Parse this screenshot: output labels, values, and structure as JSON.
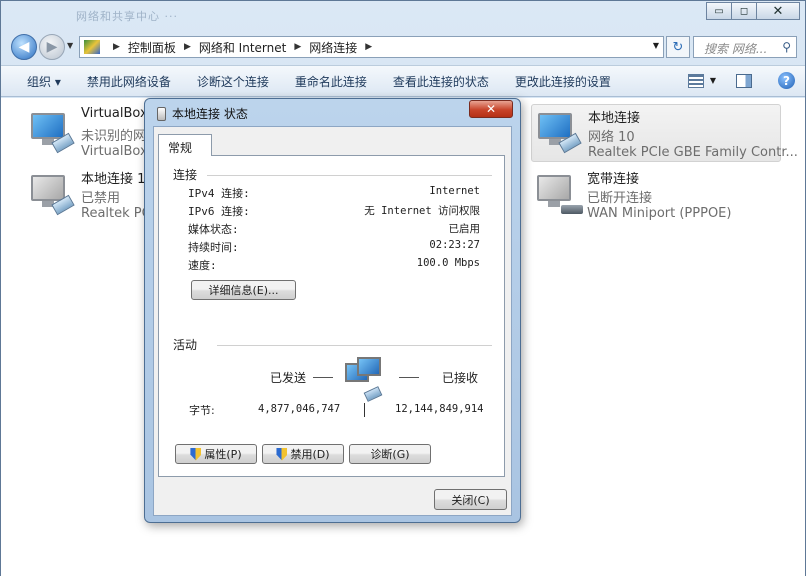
{
  "window": {
    "title_ghost": "网络和共享中心 ···",
    "min_glyph": "▭",
    "max_glyph": "◻",
    "close_glyph": "✕"
  },
  "nav": {
    "back_glyph": "◀",
    "forward_glyph": "▶",
    "breadcrumbs": [
      "控制面板",
      "网络和 Internet",
      "网络连接"
    ],
    "search_placeholder": "搜索 网络...",
    "refresh_glyph": "↻"
  },
  "toolbar": {
    "organize": "组织 ▾",
    "disable": "禁用此网络设备",
    "diagnose": "诊断这个连接",
    "rename": "重命名此连接",
    "view_status": "查看此连接的状态",
    "change_settings": "更改此连接的设置",
    "help_glyph": "?"
  },
  "connections": {
    "virtualbox": {
      "name": "VirtualBox",
      "status": "未识别的网络",
      "device": "VirtualBox"
    },
    "local1": {
      "name": "本地连接 1",
      "status": "已禁用",
      "device": "Realtek PCI"
    },
    "local": {
      "name": "本地连接",
      "status": "网络  10",
      "device": "Realtek PCIe GBE Family Contr..."
    },
    "broadband": {
      "name": "宽带连接",
      "status": "已断开连接",
      "device": "WAN Miniport (PPPOE)"
    }
  },
  "dialog": {
    "title": "本地连接 状态",
    "close_glyph": "✕",
    "tab": "常规",
    "connection_group": "连接",
    "rows": [
      {
        "k": "IPv4 连接:",
        "v": "Internet"
      },
      {
        "k": "IPv6 连接:",
        "v": "无 Internet 访问权限"
      },
      {
        "k": "媒体状态:",
        "v": "已启用"
      },
      {
        "k": "持续时间:",
        "v": "02:23:27"
      },
      {
        "k": "速度:",
        "v": "100.0 Mbps"
      }
    ],
    "details_button": "详细信息(E)...",
    "activity_group": "活动",
    "sent_label": "已发送",
    "received_label": "已接收",
    "bytes_label": "字节:",
    "bytes_sent": "4,877,046,747",
    "bytes_received": "12,144,849,914",
    "properties_button": "属性(P)",
    "disable_button": "禁用(D)",
    "diagnose_button": "诊断(G)",
    "close_button": "关闭(C)"
  }
}
